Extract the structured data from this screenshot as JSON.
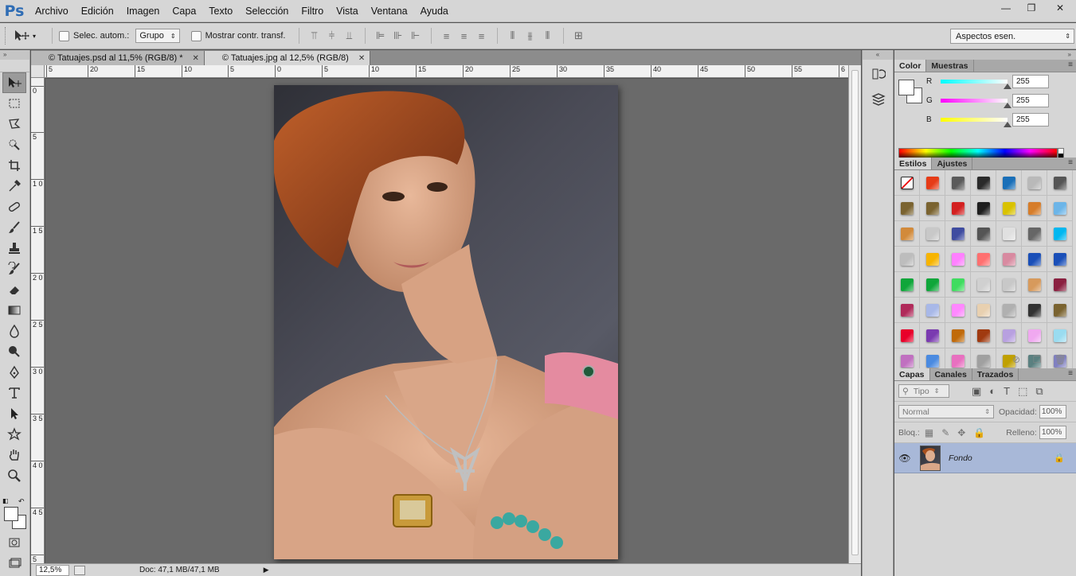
{
  "app": {
    "logo": "Ps"
  },
  "menu": [
    "Archivo",
    "Edición",
    "Imagen",
    "Capa",
    "Texto",
    "Selección",
    "Filtro",
    "Vista",
    "Ventana",
    "Ayuda"
  ],
  "window_controls": {
    "minimize": "—",
    "restore": "❐",
    "close": "✕"
  },
  "options": {
    "auto_select_label": "Selec. autom.:",
    "auto_select_value": "Grupo",
    "show_transform_label": "Mostrar contr. transf.",
    "workspace": "Aspectos esen."
  },
  "tabs": [
    {
      "label": "© Tatuajes.psd al 11,5% (RGB/8) *",
      "close": "✕"
    },
    {
      "label": "© Tatuajes.jpg al 12,5% (RGB/8)",
      "close": "✕"
    }
  ],
  "ruler_h": [
    "5",
    "20",
    "15",
    "10",
    "5",
    "0",
    "5",
    "10",
    "15",
    "20",
    "25",
    "30",
    "35",
    "40",
    "45",
    "50",
    "55",
    "6"
  ],
  "ruler_v": [
    "0",
    "5",
    "1 0",
    "1 5",
    "2 0",
    "2 5",
    "3 0",
    "3 5",
    "4 0",
    "4 5",
    "5"
  ],
  "status": {
    "zoom": "12,5%",
    "doc": "Doc: 47,1 MB/47,1 MB",
    "arrow": "▶"
  },
  "color_panel": {
    "tabs": [
      "Color",
      "Muestras"
    ],
    "r_label": "R",
    "g_label": "G",
    "b_label": "B",
    "r": "255",
    "g": "255",
    "b": "255",
    "fg": "#ffffff",
    "bg": "#ffffff"
  },
  "styles_panel": {
    "tabs": [
      "Estilos",
      "Ajustes"
    ],
    "swatches": [
      "none",
      "#e63b17",
      "#5a5a5a",
      "#2a2a2a",
      "#1a6fb8",
      "#b9b9b9",
      "#555555",
      "#7a6330",
      "#7a6330",
      "#d32020",
      "#1e1e1e",
      "#d9c200",
      "#d67d2a",
      "#6cb5e8",
      "#d28a3a",
      "#c8c8c8",
      "#3f4ca0",
      "#555555",
      "#e0e0e0",
      "#666666",
      "#00b7f0",
      "#bdbdbd",
      "#f7b400",
      "#ff80ff",
      "#ff7070",
      "#d88aa0",
      "#1a4fb8",
      "#1a4fb8",
      "#0fa63a",
      "#0fa63a",
      "#3fdc5f",
      "#d0d0d0",
      "#c8c8c8",
      "#d79a5c",
      "#8a2040",
      "#b02a5a",
      "#a8b8e8",
      "#ff88ff",
      "#e8d0b0",
      "#b0b0b0",
      "#333333",
      "#7a6330",
      "#e8002a",
      "#7a3ab0",
      "#c06a0a",
      "#a03a10",
      "#b8a0e0",
      "#f0a8f0",
      "#9adcf0",
      "#c070c0",
      "#4a8ae0",
      "#e870c0",
      "#a0a0a0",
      "#c0a000",
      "#5a8080",
      "#8080c0"
    ],
    "footer_icons": [
      "prohibit-icon",
      "new-style-icon",
      "trash-icon"
    ]
  },
  "layers_panel": {
    "tabs": [
      "Capas",
      "Canales",
      "Trazados"
    ],
    "filter": "Tipo",
    "blend_mode": "Normal",
    "opacity_label": "Opacidad:",
    "opacity": "100%",
    "lock_label": "Bloq.:",
    "fill_label": "Relleno:",
    "fill": "100%",
    "layers": [
      {
        "name": "Fondo",
        "visible": true,
        "locked": true
      }
    ]
  }
}
